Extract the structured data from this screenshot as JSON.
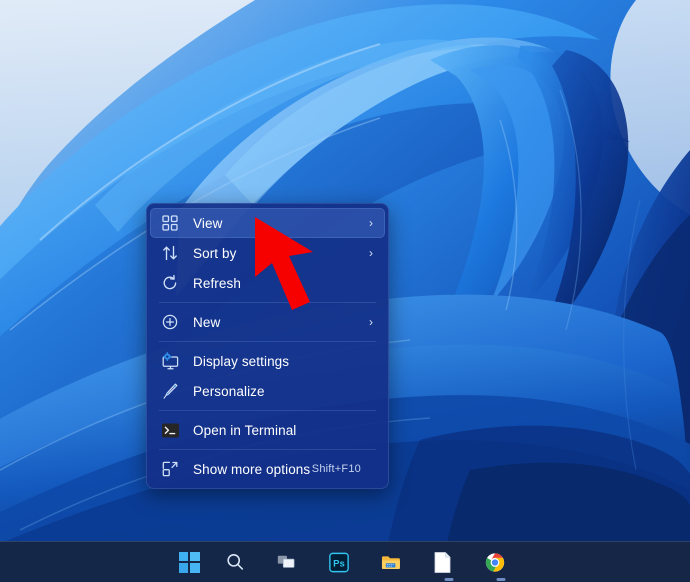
{
  "desktop": {
    "wallpaper_name": "windows-11-bloom-wallpaper",
    "colors": {
      "bg_light": "#dde6f2",
      "blue_bright": "#3aa0f5",
      "blue_mid": "#1a6fd6",
      "blue_deep": "#0f3ea8",
      "blue_dark": "#0a2160",
      "taskbar": "#172643",
      "menu_bg": "#132f88",
      "accent": "#4670c8",
      "cursor_red": "#f60000"
    }
  },
  "context_menu": {
    "name": "desktop-context-menu",
    "items": [
      {
        "id": "view",
        "label": "View",
        "icon": "grid-view-icon",
        "submenu": true,
        "shortcut": "",
        "selected": true,
        "separator_after": false
      },
      {
        "id": "sort-by",
        "label": "Sort by",
        "icon": "sort-arrows-icon",
        "submenu": true,
        "shortcut": "",
        "selected": false,
        "separator_after": false
      },
      {
        "id": "refresh",
        "label": "Refresh",
        "icon": "refresh-icon",
        "submenu": false,
        "shortcut": "",
        "selected": false,
        "separator_after": true
      },
      {
        "id": "new",
        "label": "New",
        "icon": "plus-circle-icon",
        "submenu": true,
        "shortcut": "",
        "selected": false,
        "separator_after": true
      },
      {
        "id": "display-settings",
        "label": "Display settings",
        "icon": "monitor-gear-icon",
        "submenu": false,
        "shortcut": "",
        "selected": false,
        "separator_after": false
      },
      {
        "id": "personalize",
        "label": "Personalize",
        "icon": "paintbrush-icon",
        "submenu": false,
        "shortcut": "",
        "selected": false,
        "separator_after": true
      },
      {
        "id": "open-in-terminal",
        "label": "Open in Terminal",
        "icon": "terminal-icon",
        "submenu": false,
        "shortcut": "",
        "selected": false,
        "separator_after": true
      },
      {
        "id": "show-more-options",
        "label": "Show more options",
        "icon": "expand-box-icon",
        "submenu": false,
        "shortcut": "Shift+F10",
        "selected": false,
        "separator_after": false
      }
    ]
  },
  "taskbar": {
    "items": [
      {
        "id": "start",
        "icon": "windows-start-icon",
        "label": "Start",
        "running": false
      },
      {
        "id": "search",
        "icon": "search-icon",
        "label": "Search",
        "running": false
      },
      {
        "id": "task-view",
        "icon": "task-view-icon",
        "label": "Task View",
        "running": false
      },
      {
        "id": "photoshop",
        "icon": "photoshop-icon",
        "label": "Ps",
        "running": false
      },
      {
        "id": "file-explorer",
        "icon": "file-explorer-icon",
        "label": "File Explorer",
        "running": false
      },
      {
        "id": "notepad",
        "icon": "document-icon",
        "label": "Document",
        "running": true
      },
      {
        "id": "chrome",
        "icon": "chrome-icon",
        "label": "Google Chrome",
        "running": true
      }
    ]
  },
  "cursor": {
    "name": "mouse-pointer",
    "color": "#f60000"
  }
}
